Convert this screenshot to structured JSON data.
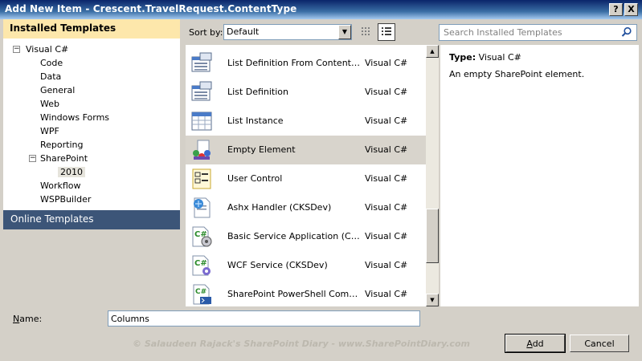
{
  "window": {
    "title": "Add New Item - Crescent.TravelRequest.ContentType",
    "help_label": "?",
    "close_label": "X"
  },
  "left": {
    "installed_header": "Installed Templates",
    "tree": [
      {
        "label": "Visual C#",
        "level": 0,
        "expander": "−"
      },
      {
        "label": "Code",
        "level": 1
      },
      {
        "label": "Data",
        "level": 1
      },
      {
        "label": "General",
        "level": 1
      },
      {
        "label": "Web",
        "level": 1
      },
      {
        "label": "Windows Forms",
        "level": 1
      },
      {
        "label": "WPF",
        "level": 1
      },
      {
        "label": "Reporting",
        "level": 1
      },
      {
        "label": "SharePoint",
        "level": 1,
        "expander": "−"
      },
      {
        "label": "2010",
        "level": 2,
        "selected": true
      },
      {
        "label": "Workflow",
        "level": 1
      },
      {
        "label": "WSPBuilder",
        "level": 1
      }
    ],
    "online_header": "Online Templates"
  },
  "toolbar": {
    "sort_label": "Sort by:",
    "sort_value": "Default",
    "search_placeholder": "Search Installed Templates"
  },
  "templates": [
    {
      "name": "List Definition From Content Type",
      "lang": "Visual C#",
      "icon": "list-definition-icon"
    },
    {
      "name": "List Definition",
      "lang": "Visual C#",
      "icon": "list-definition-icon"
    },
    {
      "name": "List Instance",
      "lang": "Visual C#",
      "icon": "list-instance-icon"
    },
    {
      "name": "Empty Element",
      "lang": "Visual C#",
      "icon": "empty-element-icon",
      "selected": true
    },
    {
      "name": "User Control",
      "lang": "Visual C#",
      "icon": "user-control-icon"
    },
    {
      "name": "Ashx Handler (CKSDev)",
      "lang": "Visual C#",
      "icon": "ashx-handler-icon"
    },
    {
      "name": "Basic Service Application (CKSDev)",
      "lang": "Visual C#",
      "icon": "csharp-service-icon"
    },
    {
      "name": "WCF Service (CKSDev)",
      "lang": "Visual C#",
      "icon": "csharp-wcf-icon"
    },
    {
      "name": "SharePoint PowerShell CommandLet",
      "lang": "Visual C#",
      "icon": "powershell-icon"
    }
  ],
  "description": {
    "type_label": "Type:",
    "type_value": "Visual C#",
    "text": "An empty SharePoint element."
  },
  "name_field": {
    "label_prefix": "N",
    "label_rest": "ame:",
    "value": "Columns"
  },
  "watermark": "© Salaudeen Rajack's SharePoint Diary - www.SharePointDiary.com",
  "buttons": {
    "add_prefix": "A",
    "add_rest": "dd",
    "cancel": "Cancel"
  },
  "colors": {
    "installed_header_bg": "#fde7ab",
    "online_header_bg": "#3c5578",
    "selected_row_bg": "#d8d4cc"
  }
}
